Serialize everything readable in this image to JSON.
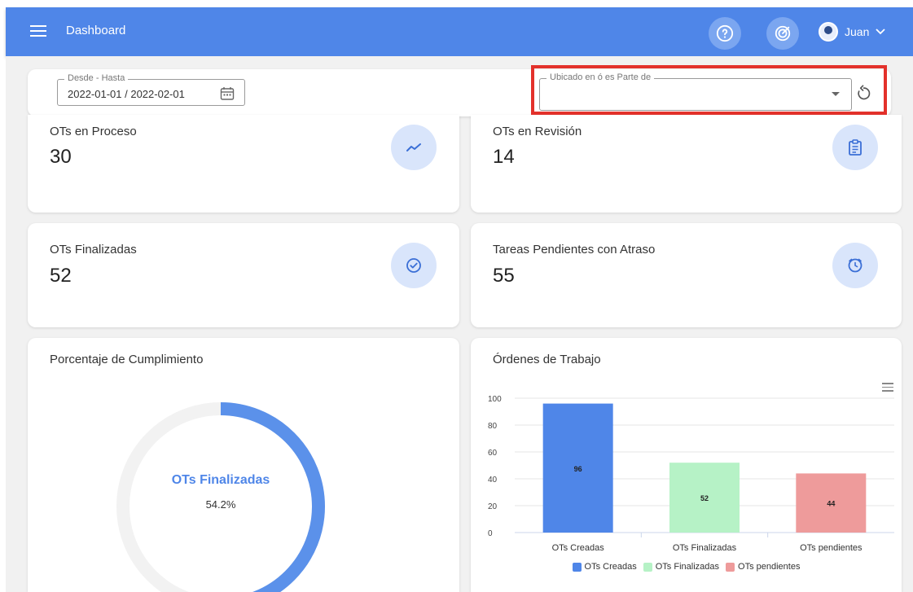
{
  "header": {
    "title": "Dashboard",
    "user_name": "Juan"
  },
  "filters": {
    "date_legend": "Desde - Hasta",
    "date_value": "2022-01-01 / 2022-02-01",
    "location_legend": "Ubicado en ó es Parte de",
    "location_value": ""
  },
  "stats": [
    {
      "title": "OTs en Proceso",
      "value": "30",
      "icon": "trend-icon"
    },
    {
      "title": "OTs en Revisión",
      "value": "14",
      "icon": "clipboard-icon"
    },
    {
      "title": "OTs Finalizadas",
      "value": "52",
      "icon": "check-circle-icon"
    },
    {
      "title": "Tareas Pendientes con Atraso",
      "value": "55",
      "icon": "clock-alert-icon"
    }
  ],
  "compliance": {
    "title": "Porcentaje de Cumplimiento",
    "label": "OTs Finalizadas",
    "percent_text": "54.2%",
    "percent": 54.2,
    "colors": {
      "fill": "#5b91ea",
      "track": "#f2f2f2"
    }
  },
  "orders_chart": {
    "title": "Órdenes de Trabajo"
  },
  "chart_data": {
    "type": "bar",
    "title": "Órdenes de Trabajo",
    "categories": [
      "OTs Creadas",
      "OTs Finalizadas",
      "OTs pendientes"
    ],
    "values": [
      96,
      52,
      44
    ],
    "colors": [
      "#4f86e8",
      "#b6f2c6",
      "#ee9b9b"
    ],
    "legend": [
      "OTs Creadas",
      "OTs Finalizadas",
      "OTs pendientes"
    ],
    "legend_position": "bottom",
    "ylim": [
      0,
      100
    ],
    "yticks": [
      0,
      20,
      40,
      60,
      80,
      100
    ],
    "grid": true
  },
  "colors": {
    "accent": "#4f86e8",
    "highlight_border": "#e3312b"
  }
}
